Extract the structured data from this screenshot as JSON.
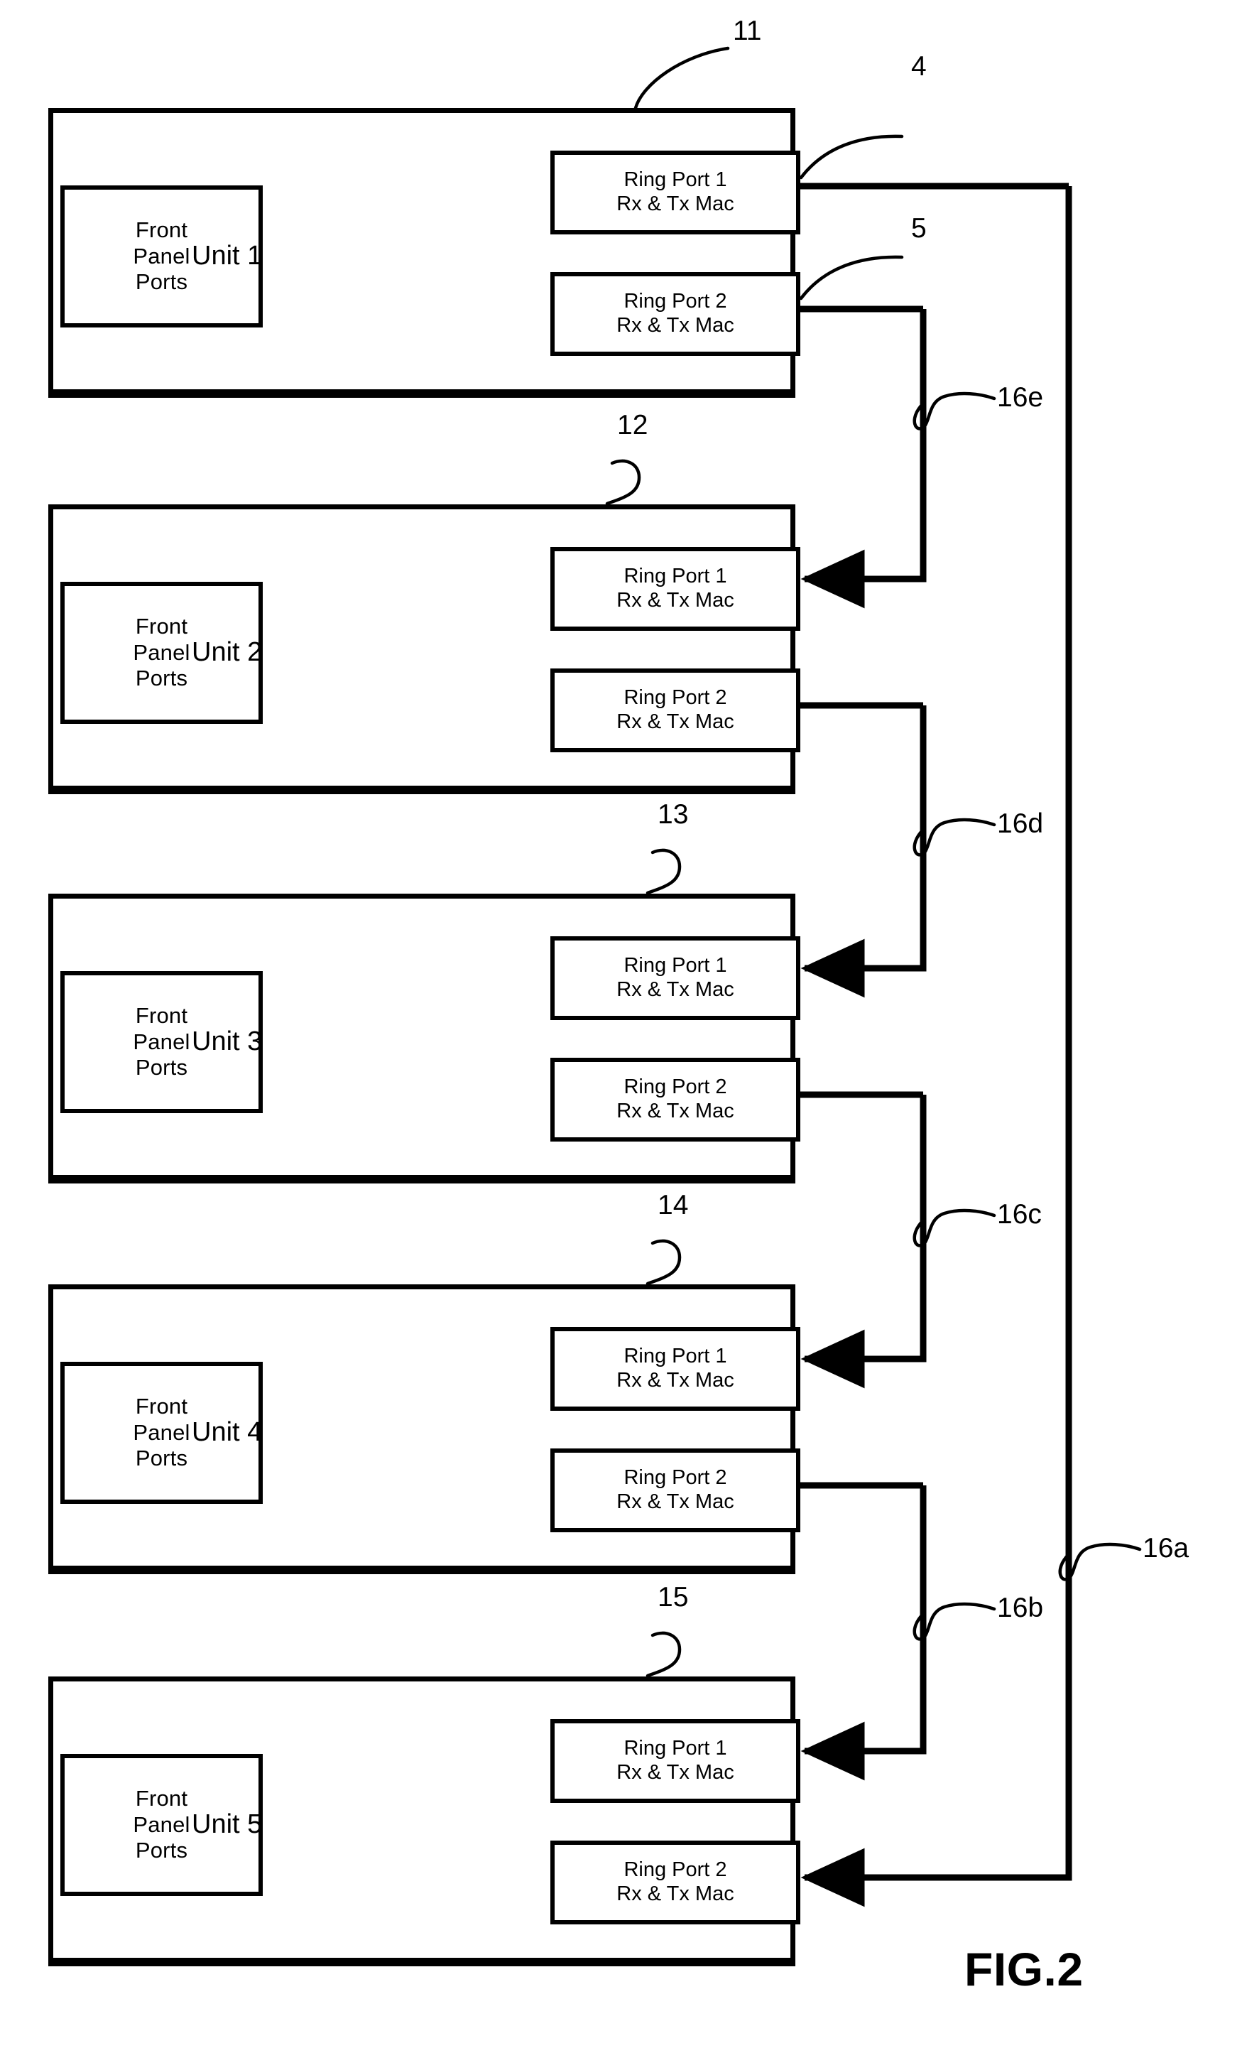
{
  "figure": {
    "caption": "FIG.2",
    "front_panel_label_lines": [
      "Front",
      "Panel",
      "Ports"
    ],
    "ring_port_1_lines": [
      "Ring Port 1",
      "Rx & Tx Mac"
    ],
    "ring_port_2_lines": [
      "Ring Port 2",
      "Rx & Tx Mac"
    ],
    "ink_color": "#000000",
    "paper_color": "#ffffff"
  },
  "units": [
    {
      "label": "Unit 1",
      "ref": "11",
      "ring_port_1": {
        "title": "Ring Port 1",
        "sub": "Rx & Tx Mac",
        "ref": "4"
      },
      "ring_port_2": {
        "title": "Ring Port 2",
        "sub": "Rx & Tx Mac",
        "ref": "5"
      }
    },
    {
      "label": "Unit 2",
      "ref": "12",
      "ring_port_1": {
        "title": "Ring Port 1",
        "sub": "Rx & Tx Mac",
        "ref": ""
      },
      "ring_port_2": {
        "title": "Ring Port 2",
        "sub": "Rx & Tx Mac",
        "ref": ""
      }
    },
    {
      "label": "Unit 3",
      "ref": "13",
      "ring_port_1": {
        "title": "Ring Port 1",
        "sub": "Rx & Tx Mac",
        "ref": ""
      },
      "ring_port_2": {
        "title": "Ring Port 2",
        "sub": "Rx & Tx Mac",
        "ref": ""
      }
    },
    {
      "label": "Unit 4",
      "ref": "14",
      "ring_port_1": {
        "title": "Ring Port 1",
        "sub": "Rx & Tx Mac",
        "ref": ""
      },
      "ring_port_2": {
        "title": "Ring Port 2",
        "sub": "Rx & Tx Mac",
        "ref": ""
      }
    },
    {
      "label": "Unit 5",
      "ref": "15",
      "ring_port_1": {
        "title": "Ring Port 1",
        "sub": "Rx & Tx Mac",
        "ref": ""
      },
      "ring_port_2": {
        "title": "Ring Port 2",
        "sub": "Rx & Tx Mac",
        "ref": ""
      }
    }
  ],
  "links": [
    {
      "ref": "16a",
      "from": "Unit 1 Ring Port 1",
      "to": "Unit 5 Ring Port 2"
    },
    {
      "ref": "16b",
      "from": "Unit 4 Ring Port 2",
      "to": "Unit 5 Ring Port 1"
    },
    {
      "ref": "16c",
      "from": "Unit 3 Ring Port 2",
      "to": "Unit 4 Ring Port 1"
    },
    {
      "ref": "16d",
      "from": "Unit 2 Ring Port 2",
      "to": "Unit 3 Ring Port 1"
    },
    {
      "ref": "16e",
      "from": "Unit 1 Ring Port 2",
      "to": "Unit 2 Ring Port 1"
    }
  ]
}
